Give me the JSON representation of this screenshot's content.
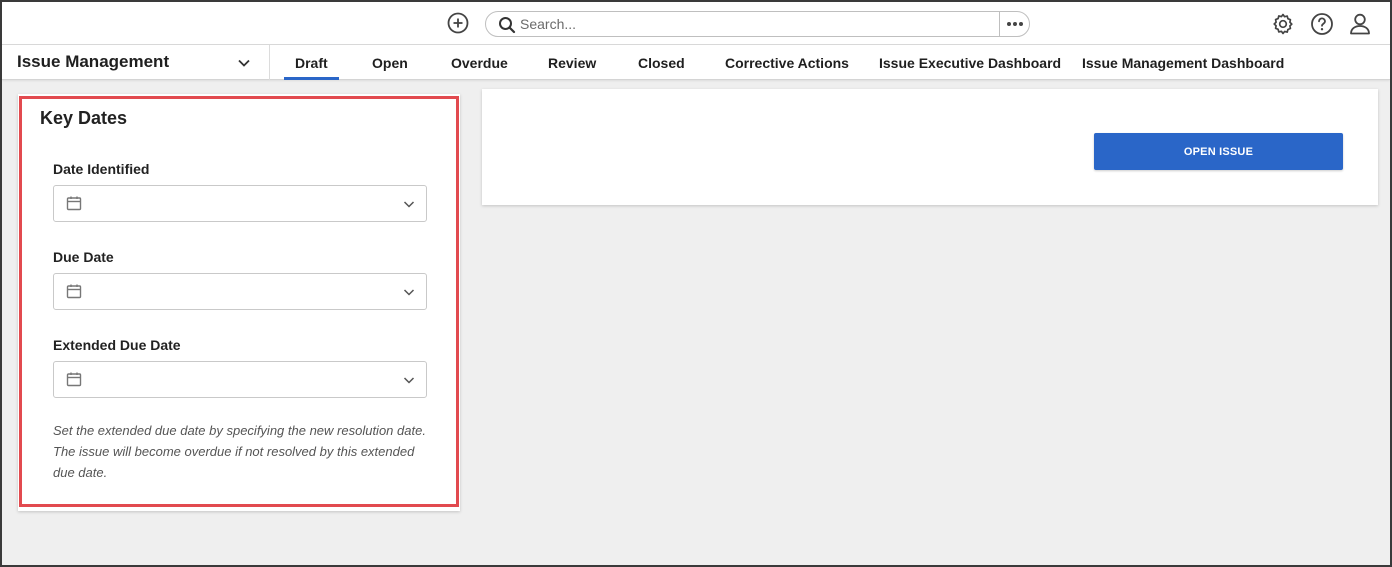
{
  "topbar": {
    "search": {
      "placeholder": "Search..."
    },
    "icons": [
      "add-circle-icon",
      "search-icon",
      "more-horizontal-icon",
      "gear-icon",
      "help-icon",
      "user-icon"
    ]
  },
  "nav": {
    "app_title": "Issue Management",
    "tabs": [
      {
        "label": "Draft",
        "active": true
      },
      {
        "label": "Open",
        "active": false
      },
      {
        "label": "Overdue",
        "active": false
      },
      {
        "label": "Review",
        "active": false
      },
      {
        "label": "Closed",
        "active": false
      },
      {
        "label": "Corrective Actions",
        "active": false
      },
      {
        "label": "Issue Executive Dashboard",
        "active": false
      },
      {
        "label": "Issue Management Dashboard",
        "active": false
      }
    ]
  },
  "key_dates": {
    "title": "Key Dates",
    "fields": [
      {
        "label": "Date Identified",
        "value": ""
      },
      {
        "label": "Due Date",
        "value": ""
      },
      {
        "label": "Extended Due Date",
        "value": ""
      }
    ],
    "help_text": "Set the extended due date by specifying the new resolution date. The issue will become overdue if not resolved by this extended due date."
  },
  "actions": {
    "open_issue_label": "OPEN ISSUE"
  },
  "colors": {
    "accent": "#2a66c8",
    "highlight": "#e24a4f",
    "background": "#efefef"
  }
}
